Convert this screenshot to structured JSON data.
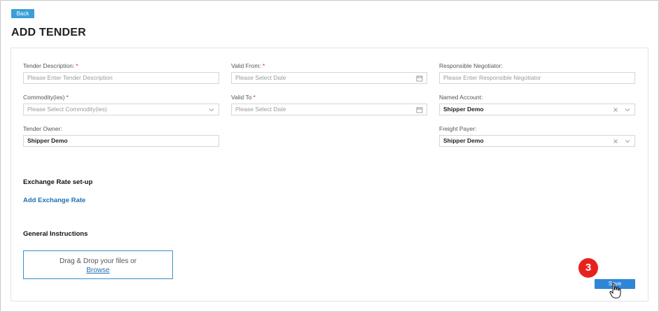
{
  "header": {
    "back_label": "Back",
    "title": "ADD TENDER"
  },
  "form": {
    "tender_description": {
      "label": "Tender Description:",
      "required": "*",
      "placeholder": "Please Enter Tender Description"
    },
    "valid_from": {
      "label": "Valid From:",
      "required": "*",
      "placeholder": "Please Select Date"
    },
    "responsible_negotiator": {
      "label": "Responsible Negotiator:",
      "placeholder": "Please Enter Responsible Negotiator"
    },
    "commodities": {
      "label": "Commodity(ies)",
      "required": "*",
      "placeholder": "Please Select Commodity(ies)"
    },
    "valid_to": {
      "label": "Valid To",
      "required": "*",
      "placeholder": "Please Select Date"
    },
    "named_account": {
      "label": "Named Account:",
      "value": "Shipper Demo"
    },
    "tender_owner": {
      "label": "Tender Owner:",
      "value": "Shipper Demo"
    },
    "freight_payer": {
      "label": "Freight Payer:",
      "value": "Shipper Demo"
    }
  },
  "exchange": {
    "heading": "Exchange Rate set-up",
    "add_label": "Add Exchange Rate"
  },
  "instructions": {
    "heading": "General Instructions",
    "drop_text": "Drag & Drop your files or",
    "browse_label": "Browse"
  },
  "footer": {
    "save_label": "Save",
    "step_badge": "3"
  },
  "colors": {
    "accent": "#2f86d9",
    "link": "#1f6fb5",
    "badge": "#e8211d",
    "required": "#d0342c"
  },
  "icons": [
    "calendar-icon",
    "chevron-down-icon",
    "clear-icon",
    "hand-cursor-icon"
  ]
}
